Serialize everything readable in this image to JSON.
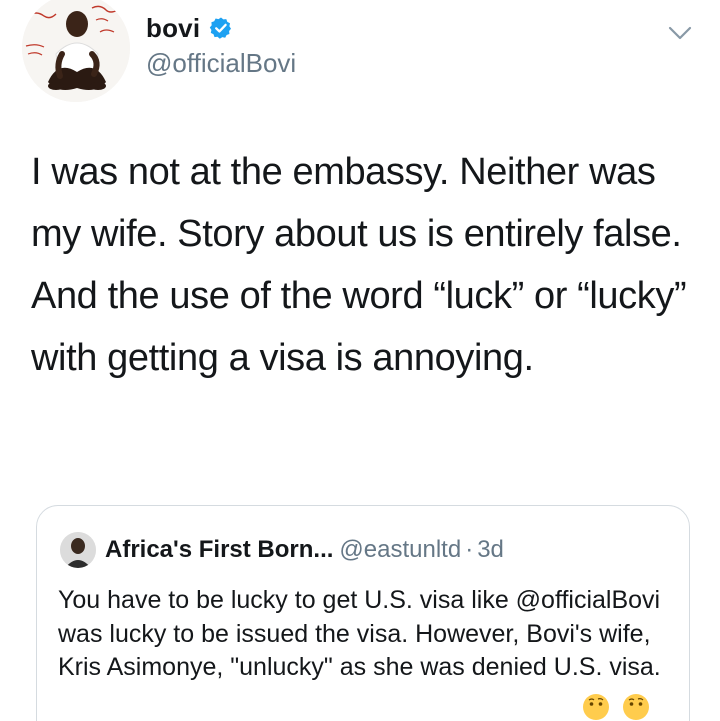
{
  "tweet": {
    "author": {
      "display_name": "bovi",
      "handle": "@officialBovi",
      "verified": true
    },
    "text": "I was not at the embassy. Neither was my wife. Story about us is entirely false. And the use of the word “luck” or “lucky” with getting a visa is annoying.",
    "menu_icon": "chevron-down-icon"
  },
  "quoted_tweet": {
    "display_name": "Africa's First Born...",
    "handle": "@eastunltd",
    "separator": "·",
    "time": "3d",
    "text": "You have to be lucky to get U.S. visa like @officialBovi was lucky to be issued the visa. However, Bovi's wife, Kris Asimonye, \"unlucky\" as she was denied U.S. visa.",
    "emojis": [
      "thinking-face-emoji",
      "thinking-face-emoji"
    ]
  },
  "colors": {
    "text": "#14171a",
    "secondary": "#657786",
    "verified_blue": "#1da1f2",
    "border": "#d5dbe0"
  }
}
